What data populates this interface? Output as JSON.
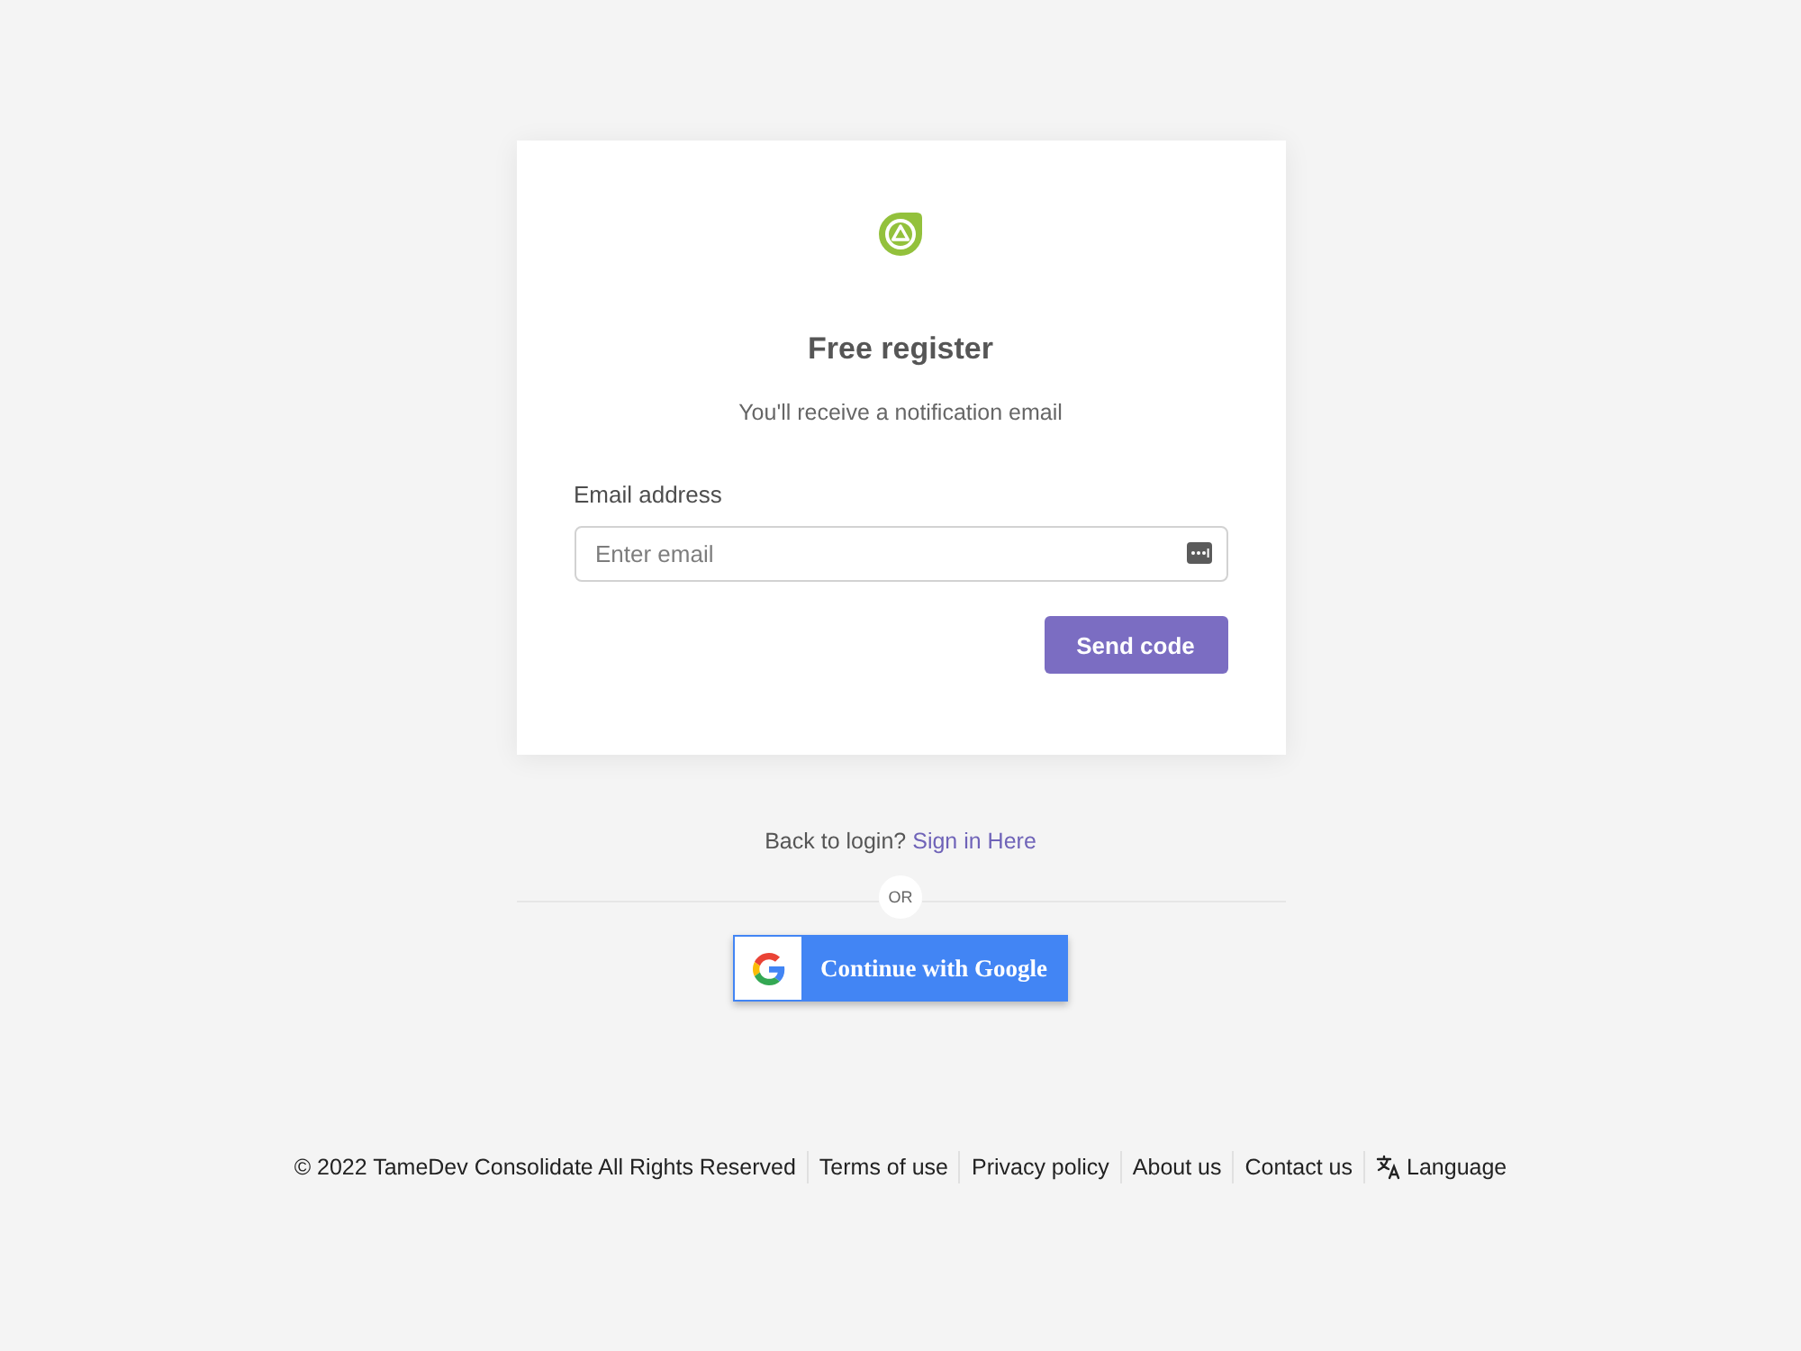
{
  "card": {
    "title": "Free register",
    "subtitle": "You'll receive a notification email",
    "email_field": {
      "label": "Email address",
      "placeholder": "Enter email"
    },
    "submit_button": "Send code"
  },
  "login_prompt": {
    "text": "Back to login?",
    "link": "Sign in Here"
  },
  "divider": {
    "label": "OR"
  },
  "google_button": {
    "label": "Continue with Google"
  },
  "footer": {
    "copyright": "© 2022 TameDev Consolidate All Rights Reserved",
    "links": [
      {
        "label": "Terms of use",
        "kind": "link"
      },
      {
        "label": "Privacy policy",
        "kind": "link"
      },
      {
        "label": "About us",
        "kind": "link"
      },
      {
        "label": "Contact us",
        "kind": "link"
      },
      {
        "label": "Language",
        "kind": "language"
      }
    ]
  }
}
